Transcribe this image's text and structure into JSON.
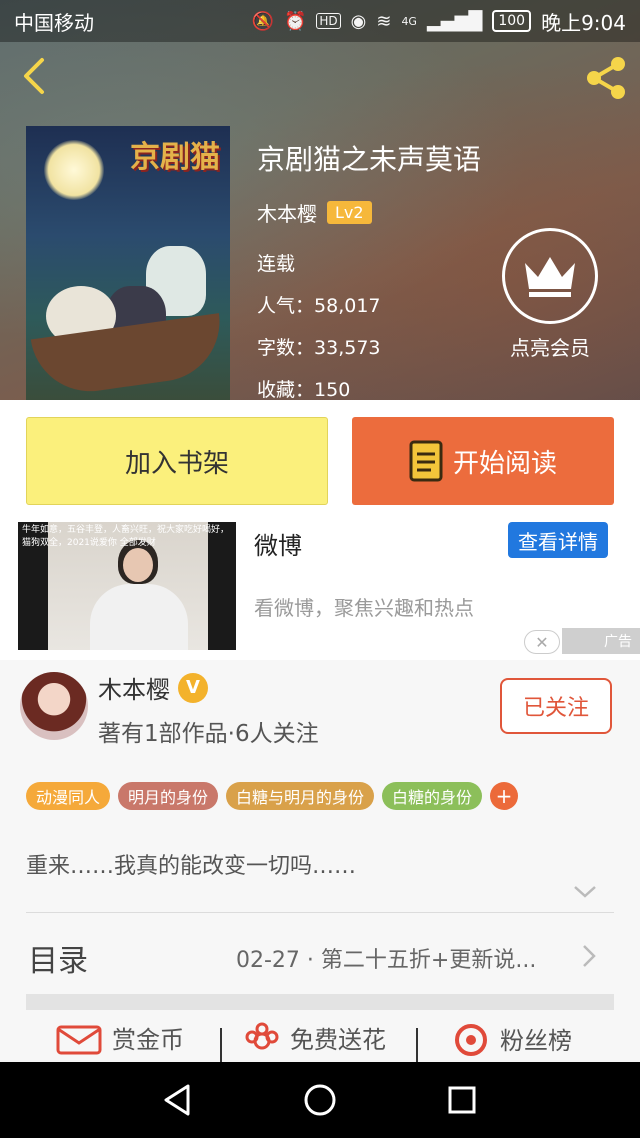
{
  "status_bar": {
    "carrier": "中国移动",
    "network": "4G",
    "battery": "100",
    "time": "晚上9:04"
  },
  "book": {
    "title": "京剧猫之未声莫语",
    "cover_text": "京剧猫",
    "author": "木本樱",
    "level": "Lv2",
    "status": "连载",
    "popularity_label": "人气：",
    "popularity": "58,017",
    "word_count_label": "字数：",
    "word_count": "33,573",
    "favorites_label": "收藏：",
    "favorites": "150"
  },
  "vip": {
    "label": "点亮会员"
  },
  "buttons": {
    "add_shelf": "加入书架",
    "start_read": "开始阅读"
  },
  "ad": {
    "title": "微博",
    "detail_button": "查看详情",
    "description": "看微博，聚焦兴趣和热点",
    "thumb_caption": "牛年如意，五谷丰登，人畜兴旺，祝大家吃好喝好，猫狗双全，2021说爱你 全部发财",
    "tag": "广告"
  },
  "author_card": {
    "name": "木本樱",
    "verified_badge": "V",
    "stats": "著有1部作品·6人关注",
    "follow_button": "已关注"
  },
  "tags": [
    {
      "label": "动漫同人",
      "color": "#f5a93a"
    },
    {
      "label": "明月的身份",
      "color": "#c9786a"
    },
    {
      "label": "白糖与明月的身份",
      "color": "#d9a14a"
    },
    {
      "label": "白糖的身份",
      "color": "#8cbf5a"
    }
  ],
  "tag_add": "+",
  "summary": "重来……我真的能改变一切吗……",
  "toc": {
    "label": "目录",
    "latest": "02-27 · 第二十五折+更新说..."
  },
  "actions": [
    {
      "label": "赏金币",
      "icon": "envelope-icon"
    },
    {
      "label": "免费送花",
      "icon": "flower-icon"
    },
    {
      "label": "粉丝榜",
      "icon": "medal-icon"
    }
  ],
  "colors": {
    "shelf_button": "#fbf07c",
    "read_button": "#ec6c3d",
    "detail_button": "#2178df",
    "follow_accent": "#e0563a",
    "level_badge": "#f6b83b"
  }
}
